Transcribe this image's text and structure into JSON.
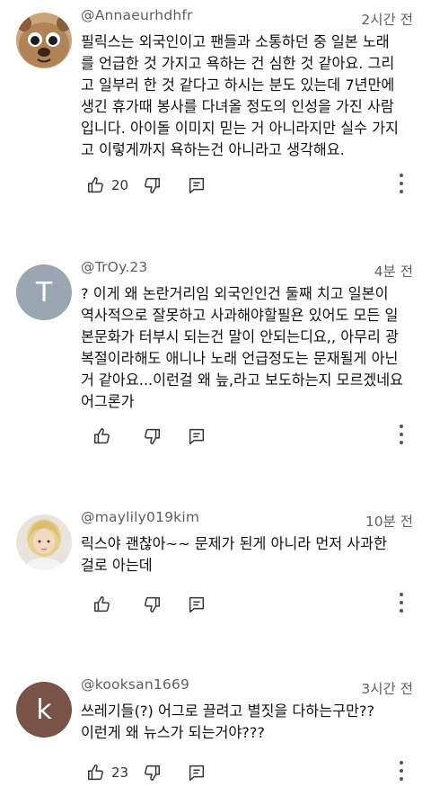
{
  "comments": [
    {
      "author": "@Annaeurhdhfr",
      "time": "2시간 전",
      "lines": [
        "필릭스는 외국인이고 팬들과 소통하던 중 일본 노래",
        "를 언급한 것 가지고 욕하는 건 심한 것 같아요. 그리",
        "고 일부러 한 것 같다고 하시는 분도 있는데 7년만에",
        "생긴 휴가때 봉사를 다녀올 정도의 인성을 가진 사람",
        "입니다. 아이돌 이미지 믿는 거 아니라지만 실수 가지",
        "고 이렇게까지 욕하는건 아니라고 생각해요."
      ],
      "likes": "20",
      "avatar_icon": "animal-face-avatar"
    },
    {
      "author": "@TrOy.23",
      "time": "4분 전",
      "avatar_letter": "T",
      "avatar_color": "#9aa6b2",
      "lines": [
        "? 이게 왜 논란거리임 외국인인건 둘째 치고 일본이",
        "역사적으로 잘못하고 사과해야할필욘 있어도 모든 일",
        "본문화가 터부시 되는건 말이 안되는디요,, 아무리 광",
        "복절이라해도 애니나 노래 언급정도는 문재될게 아닌",
        "거 같아요...이런걸 왜 늪,라고 보도하는지 모르겠네요",
        "어그론가"
      ],
      "likes": ""
    },
    {
      "author": "@maylily019kim",
      "time": "10분 전",
      "lines": [
        "릭스야 괜찮아~~   문제가 된게 아니라  먼저 사과한",
        "걸로 아는데"
      ],
      "likes": "",
      "avatar_icon": "person-photo-avatar"
    },
    {
      "author": "@kooksan1669",
      "time": "3시간 전",
      "avatar_letter": "k",
      "avatar_color": "#7a5348",
      "lines": [
        "쓰레기들(?)  어그로 끌려고 별짓을 다하는구만??",
        "이런게 왜 뉴스가 되는거야???"
      ],
      "likes": "23"
    }
  ],
  "colors": {
    "meta_text": "#606060",
    "body_text": "#111111",
    "icon": "#333333"
  }
}
